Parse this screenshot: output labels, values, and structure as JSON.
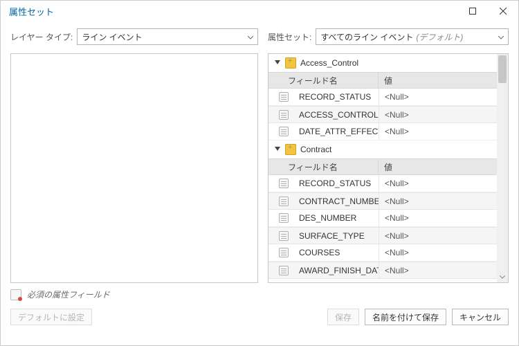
{
  "window": {
    "title": "属性セット"
  },
  "layer": {
    "label": "レイヤー タイプ:",
    "value": "ライン イベント"
  },
  "attrset": {
    "label": "属性セット:",
    "value": "すべてのライン イベント",
    "default_hint": "(デフォルト)"
  },
  "headers": {
    "field_name": "フィールド名",
    "value": "値"
  },
  "groups": [
    {
      "name": "Access_Control",
      "fields": [
        {
          "name": "RECORD_STATUS",
          "value": "<Null>"
        },
        {
          "name": "ACCESS_CONTROL",
          "value": "<Null>"
        },
        {
          "name": "DATE_ATTR_EFFECTIVE",
          "value": "<Null>"
        }
      ]
    },
    {
      "name": "Contract",
      "fields": [
        {
          "name": "RECORD_STATUS",
          "value": "<Null>"
        },
        {
          "name": "CONTRACT_NUMBER",
          "value": "<Null>"
        },
        {
          "name": "DES_NUMBER",
          "value": "<Null>"
        },
        {
          "name": "SURFACE_TYPE",
          "value": "<Null>"
        },
        {
          "name": "COURSES",
          "value": "<Null>"
        },
        {
          "name": "AWARD_FINISH_DATE",
          "value": "<Null>"
        }
      ]
    }
  ],
  "footer": {
    "required_hint": "必須の属性フィールド"
  },
  "buttons": {
    "set_default": "デフォルトに設定",
    "save": "保存",
    "save_as": "名前を付けて保存",
    "cancel": "キャンセル"
  }
}
